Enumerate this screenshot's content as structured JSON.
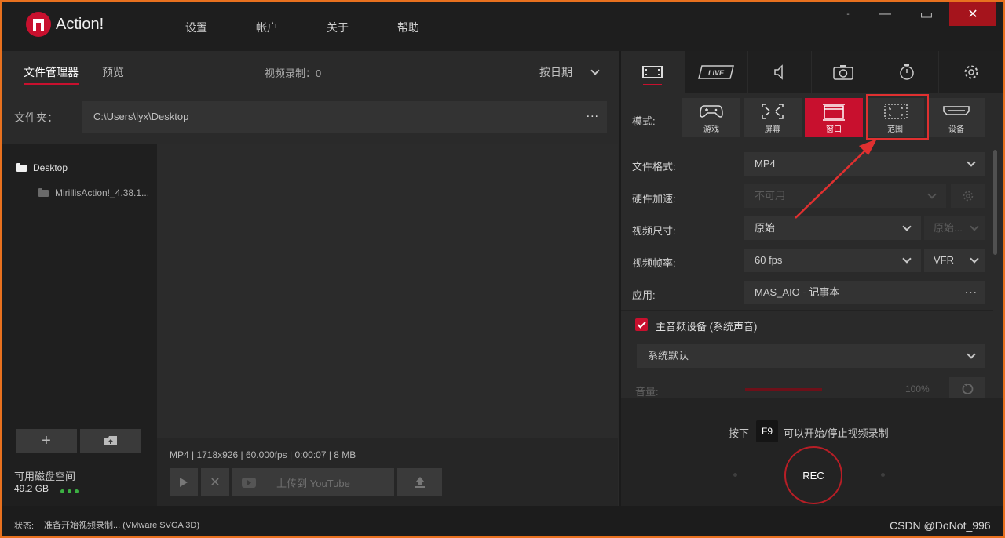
{
  "app": {
    "title": "Action!"
  },
  "menu": [
    "设置",
    "帐户",
    "关于",
    "帮助"
  ],
  "window_controls": {
    "minimize_small": "-",
    "minimize": "—",
    "maximize": "▭",
    "close": "✕"
  },
  "left_tabs": {
    "file_manager": "文件管理器",
    "preview": "预览"
  },
  "recording_count": {
    "label": "视频录制：",
    "value": "0"
  },
  "sort": {
    "label": "按日期"
  },
  "folder": {
    "label": "文件夹：",
    "path": "C:\\Users\\lyx\\Desktop",
    "more": "..."
  },
  "tree": [
    {
      "label": "Desktop"
    },
    {
      "label": "MirillisAction!_4.38.1..."
    }
  ],
  "tree_buttons": {
    "add": "+",
    "open": "folder-up-icon"
  },
  "disk": {
    "label": "可用磁盘空间",
    "size": "49.2 GB"
  },
  "file_info": "MP4 | 1718x926 | 60.000fps | 0:00:07 | 8 MB",
  "upload": {
    "label": "上传到 YouTube"
  },
  "right_tabs": [
    "video-icon",
    "live-icon",
    "audio-icon",
    "camera-icon",
    "timer-icon",
    "gear-icon"
  ],
  "live_label": "LIVE",
  "mode": {
    "label": "模式:",
    "options": [
      {
        "label": "游戏",
        "active": false
      },
      {
        "label": "屏幕",
        "active": false
      },
      {
        "label": "窗口",
        "active": true
      },
      {
        "label": "范围",
        "active": false
      },
      {
        "label": "设备",
        "active": false
      }
    ]
  },
  "settings": {
    "format": {
      "label": "文件格式:",
      "value": "MP4"
    },
    "hw_accel": {
      "label": "硬件加速:",
      "value": "不可用"
    },
    "size": {
      "label": "视频尺寸:",
      "value": "原始",
      "secondary": "原始..."
    },
    "fps": {
      "label": "视频帧率:",
      "value": "60 fps",
      "mode": "VFR"
    },
    "app": {
      "label": "应用:",
      "value": "MAS_AIO - 记事本",
      "more": "..."
    }
  },
  "audio": {
    "checkbox_label": "主音频设备 (系统声音)",
    "checked": true,
    "device": "系统默认",
    "volume_label": "音量:",
    "volume_pct": "100%",
    "volume_level": 1.0
  },
  "record": {
    "prefix": "按下",
    "key": "F9",
    "suffix": "可以开始/停止视频录制",
    "button": "REC"
  },
  "status": {
    "label": "状态:",
    "text": "准备开始视频录制... (VMware SVGA 3D)"
  },
  "watermark": "CSDN @DoNot_996",
  "colors": {
    "accent": "#c8102e",
    "frame": "#e8711f",
    "annotation": "#e03030"
  }
}
